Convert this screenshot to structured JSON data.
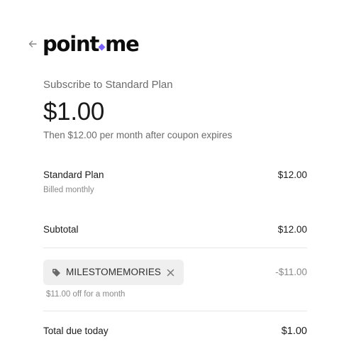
{
  "header": {
    "back_icon": "arrow-left-icon",
    "logo_part1": "point",
    "logo_part2": "me",
    "logo_accent_color": "#7b61ff"
  },
  "summary": {
    "subscribe_title": "Subscribe to Standard Plan",
    "price": "$1.00",
    "price_note": "Then $12.00 per month after coupon expires"
  },
  "line_items": {
    "plan_name": "Standard Plan",
    "plan_billing": "Billed monthly",
    "plan_amount": "$12.00",
    "subtotal_label": "Subtotal",
    "subtotal_amount": "$12.00"
  },
  "coupon": {
    "tag_icon": "tag-icon",
    "code": "MILESTOMEMORIES",
    "remove_icon": "close-icon",
    "note": "$11.00 off for a month",
    "discount_amount": "-$11.00"
  },
  "total": {
    "label": "Total due today",
    "amount": "$1.00"
  }
}
